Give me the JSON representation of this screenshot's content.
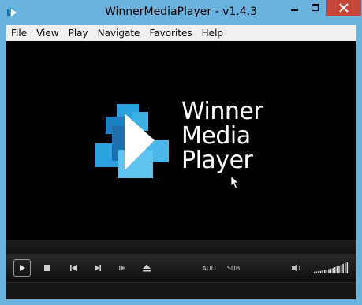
{
  "window": {
    "title": "WinnerMediaPlayer - v1.4.3"
  },
  "menu": [
    {
      "label": "File"
    },
    {
      "label": "View"
    },
    {
      "label": "Play"
    },
    {
      "label": "Navigate"
    },
    {
      "label": "Favorites"
    },
    {
      "label": "Help"
    }
  ],
  "logo": {
    "line1": "Winner",
    "line2": "Media",
    "line3": "Player",
    "accent": "#2aa3e0"
  },
  "controls": {
    "audio_label": "AUD",
    "subtitle_label": "SUB"
  },
  "colors": {
    "close_button": "#c7463a",
    "frame": "#6bb3df",
    "video_bg": "#000000"
  }
}
